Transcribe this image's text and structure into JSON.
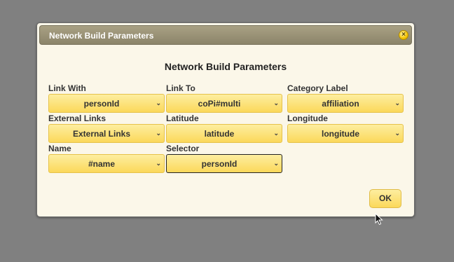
{
  "dialog": {
    "title": "Network Build Parameters",
    "close_icon": "close-icon",
    "heading": "Network Build Parameters"
  },
  "fields": {
    "link_with": {
      "label": "Link With",
      "value": "personId"
    },
    "link_to": {
      "label": "Link To",
      "value": "coPi#multi"
    },
    "category_label": {
      "label": "Category Label",
      "value": "affiliation"
    },
    "external_links": {
      "label": "External Links",
      "value": "External Links"
    },
    "latitude": {
      "label": "Latitude",
      "value": "latitude"
    },
    "longitude": {
      "label": "Longitude",
      "value": "longitude"
    },
    "name": {
      "label": "Name",
      "value": "#name"
    },
    "selector": {
      "label": "Selector",
      "value": "personId"
    }
  },
  "buttons": {
    "ok": "OK"
  },
  "colors": {
    "background": "#808080",
    "dialog_bg": "#fbf7e9",
    "titlebar": "#9b9478",
    "select_fill": "#fbd85a",
    "close": "#f5c400"
  }
}
